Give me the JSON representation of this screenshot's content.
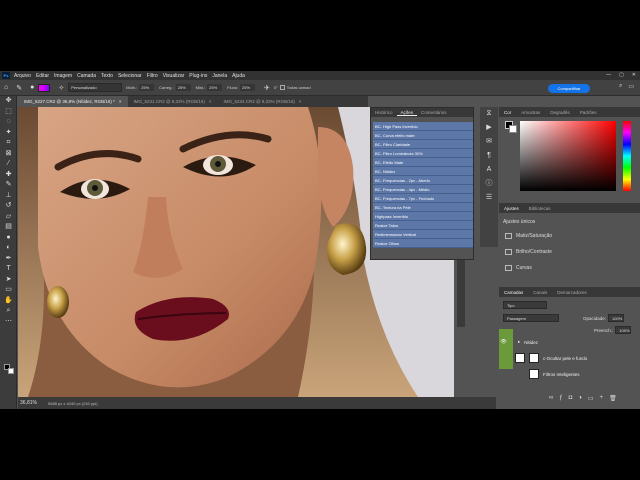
{
  "menubar": {
    "logo": "Ps",
    "items": [
      "Arquivo",
      "Editar",
      "Imagem",
      "Camada",
      "Texto",
      "Selecionar",
      "Filtro",
      "Visualizar",
      "Plug-ins",
      "Janela",
      "Ajuda"
    ],
    "window_controls": [
      "—",
      "▢",
      "✕"
    ]
  },
  "options": {
    "preset": "Personalizado",
    "fields": [
      {
        "label": "Molh.:",
        "value": "25%"
      },
      {
        "label": "Carreg.:",
        "value": "25%"
      },
      {
        "label": "Mist.:",
        "value": "25%"
      },
      {
        "label": "Fluxo:",
        "value": "25%"
      }
    ],
    "angle": "0°",
    "sample_all_label": "Todas camad",
    "share_label": "Compartilhar"
  },
  "tabs": [
    {
      "label": "IMG_5227.CR2 @ 36,8% (Nítidez, RGB/16) *",
      "active": true
    },
    {
      "label": "IMG_5231.CR2 @ 8,33% (RGB/16)",
      "active": false
    },
    {
      "label": "IMG_5234.CR2 @ 8,33% (RGB/16)",
      "active": false
    }
  ],
  "actions_panel": {
    "tabs": [
      "Histórico",
      "Ações",
      "Comentários"
    ],
    "active_tab": "Ações",
    "items": [
      "BC- High Pass Invertido",
      "BC- Curva efeito mate",
      "BC- Filtro Claridade",
      "BC- Filtro Luminância 30%",
      "BC- Efeito Mate",
      "BC- Nitidez",
      "BC- Frequencias - 2px - Aberto",
      "BC- Frequencias - 4px - Médio",
      "BC- Frequencias - 7px - Fechado",
      "BC- Textura na Pele",
      "Highpass Invertido",
      "Realce Tatoo",
      "Redimensionar Vertical",
      "Realce Olhos"
    ]
  },
  "color_panel": {
    "tabs": [
      "Cor",
      "Amostras",
      "Degradês",
      "Padrões"
    ]
  },
  "adjustments_panel": {
    "tabs": [
      "Ajustes",
      "Bibliotecas"
    ],
    "heading": "Ajustes únicos",
    "items": [
      "Matiz/Saturação",
      "Brilho/Contraste",
      "Curvas"
    ]
  },
  "layers_panel": {
    "tabs": [
      "Camadas",
      "Canais",
      "Demarcadores"
    ],
    "filter": "Tipo",
    "blend_mode": "Passagem",
    "opacity_label": "Opacidade:",
    "opacity": "100%",
    "fill_label": "Preench.:",
    "fill": "100%",
    "layers": [
      {
        "name": "Nitidez"
      },
      {
        "name": "c-Ocultar pele e fundo"
      },
      {
        "name": "Filtros Inteligentes"
      }
    ]
  },
  "status": {
    "zoom": "36,81%",
    "docinfo": "5688 px x 4240 px (240 ppi)"
  },
  "colors": {
    "accent": "#1473e6",
    "action_highlight": "#5d78a8",
    "layer_highlight": "#6a9a3a"
  }
}
